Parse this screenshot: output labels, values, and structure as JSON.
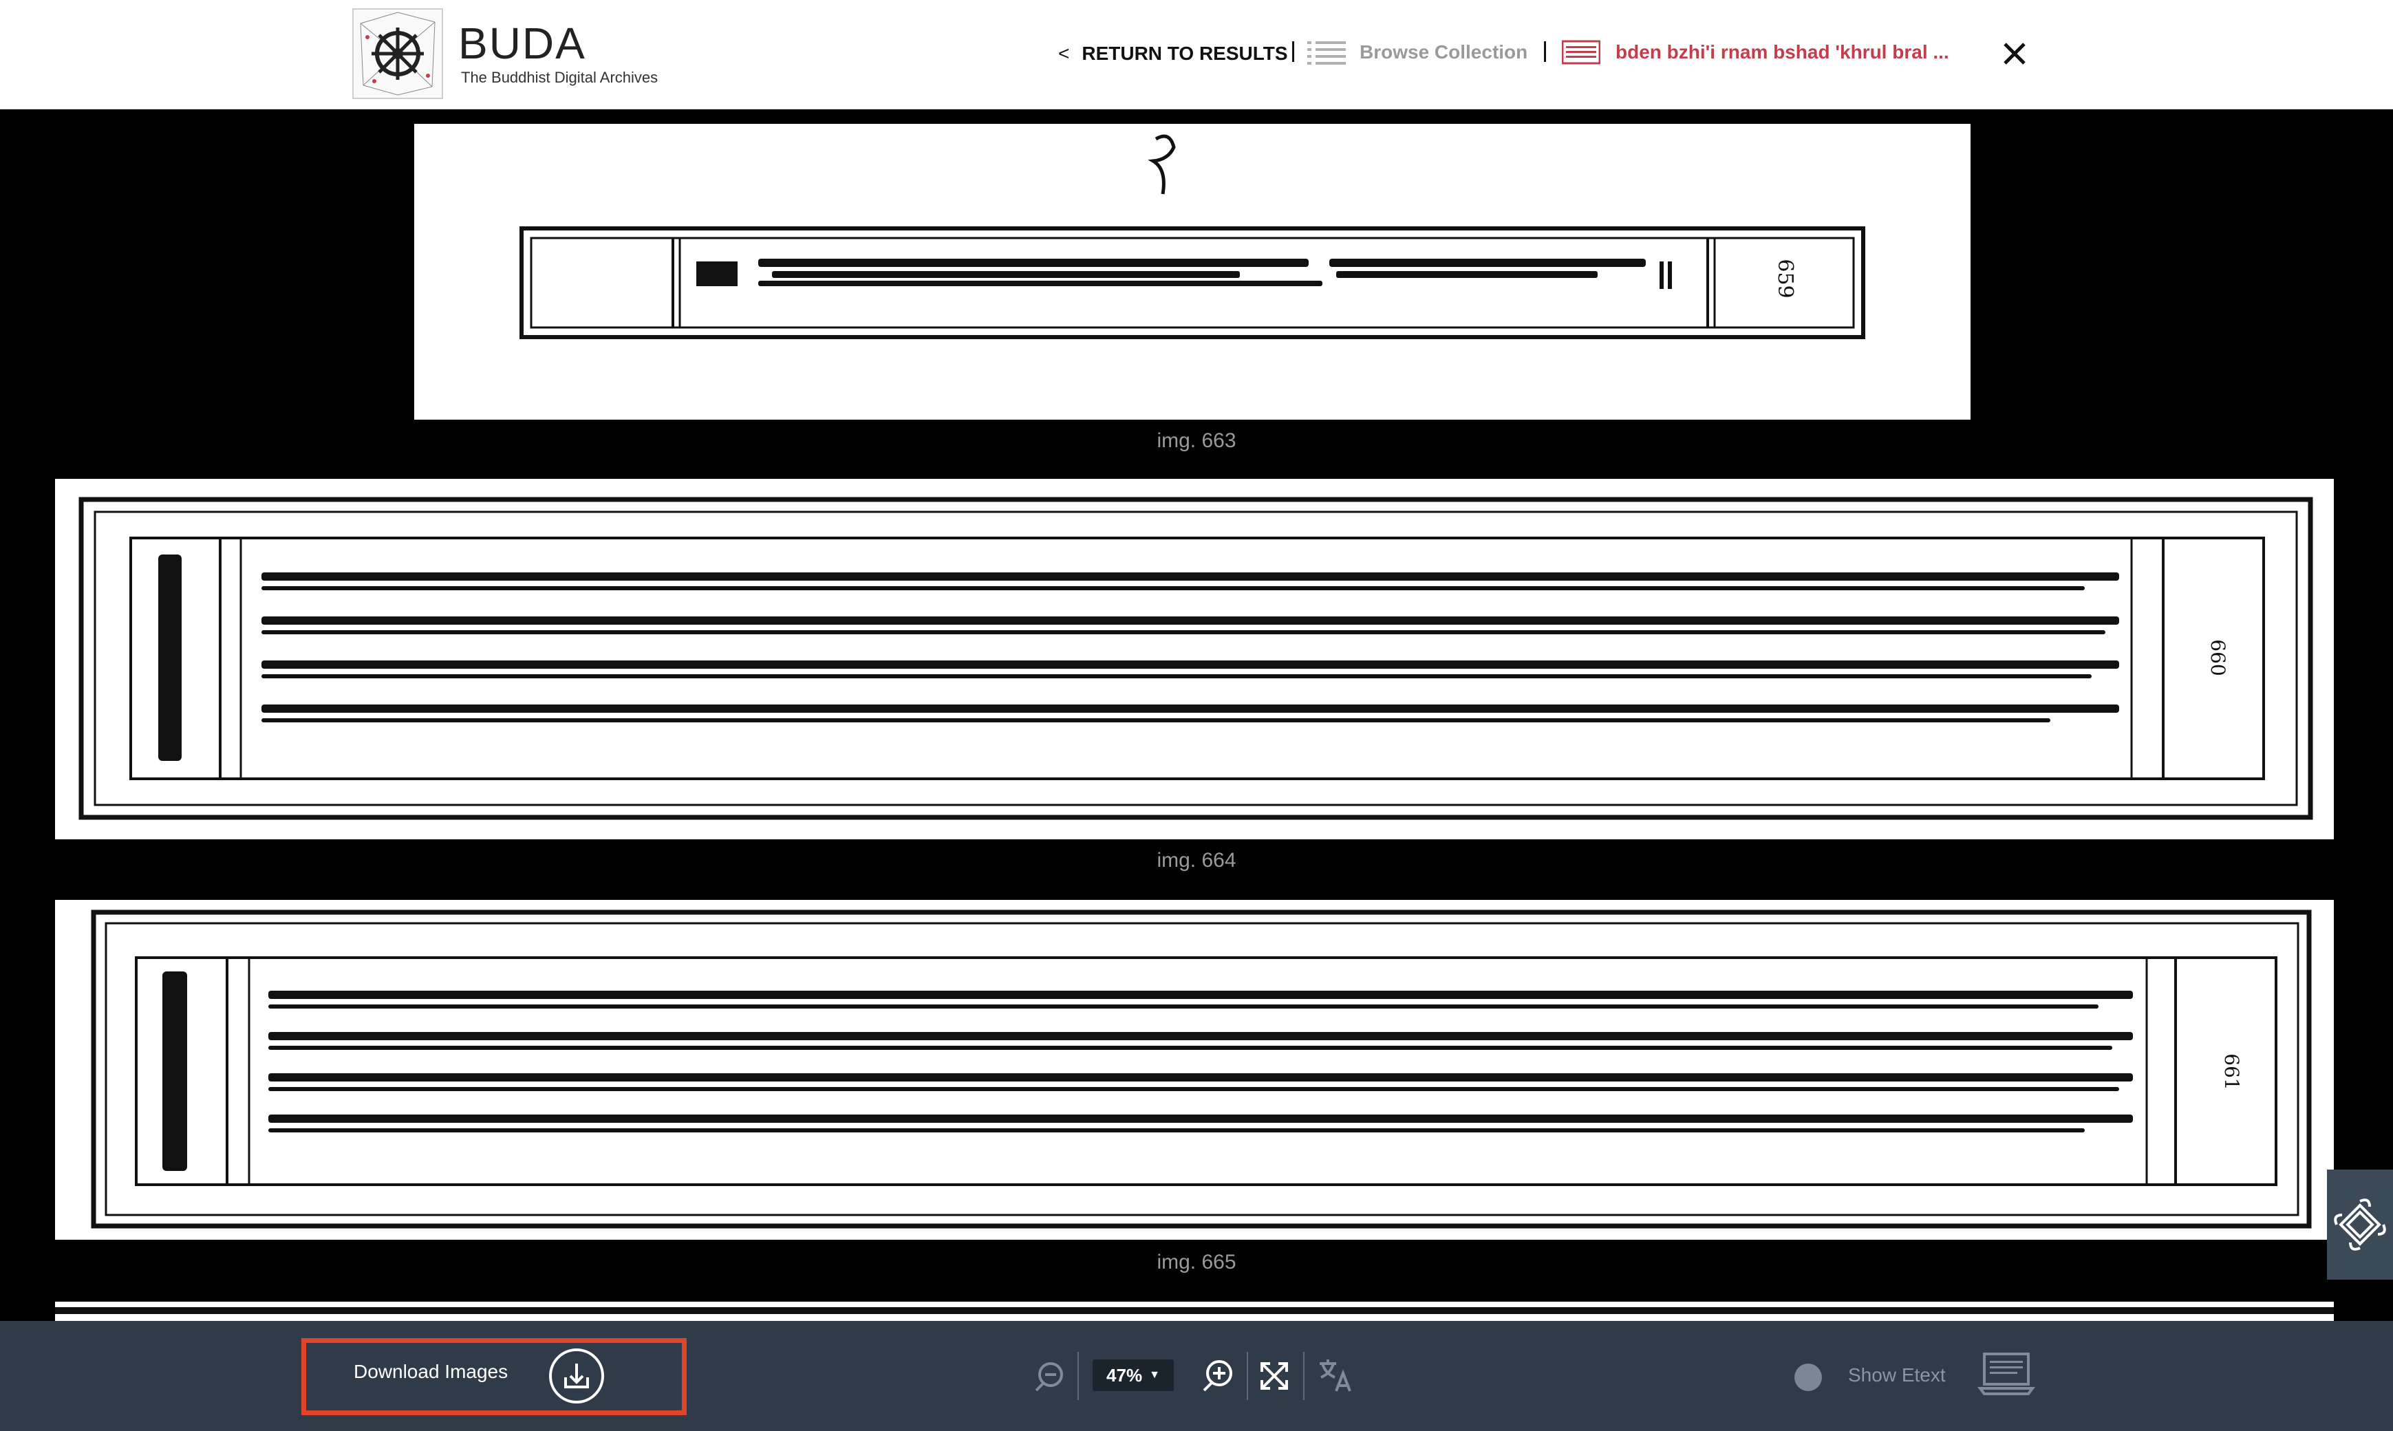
{
  "header": {
    "brand_title": "BUDA",
    "brand_subtitle": "The Buddhist Digital Archives",
    "return_label": "RETURN TO RESULTS",
    "return_chevron": "<",
    "browse_label": "Browse Collection",
    "current_work_label": "bden bzhi'i rnam bshad 'khrul bral ...",
    "accent_color": "#c43d4b"
  },
  "pages": [
    {
      "label": "img. 663",
      "folio": "659"
    },
    {
      "label": "img. 664",
      "folio": "660"
    },
    {
      "label": "img. 665",
      "folio": "661"
    }
  ],
  "toolbar": {
    "download_label": "Download Images",
    "zoom_value": "47%",
    "show_etext_label": "Show Etext",
    "highlight_color": "#e0442b"
  },
  "icons": {
    "download": "download-icon",
    "zoom_out": "zoom-out-icon",
    "zoom_in": "zoom-in-icon",
    "fullscreen": "fullscreen-icon",
    "translate": "translate-icon",
    "etext": "etext-icon",
    "close": "close-icon",
    "side": "endless-knot-icon"
  }
}
